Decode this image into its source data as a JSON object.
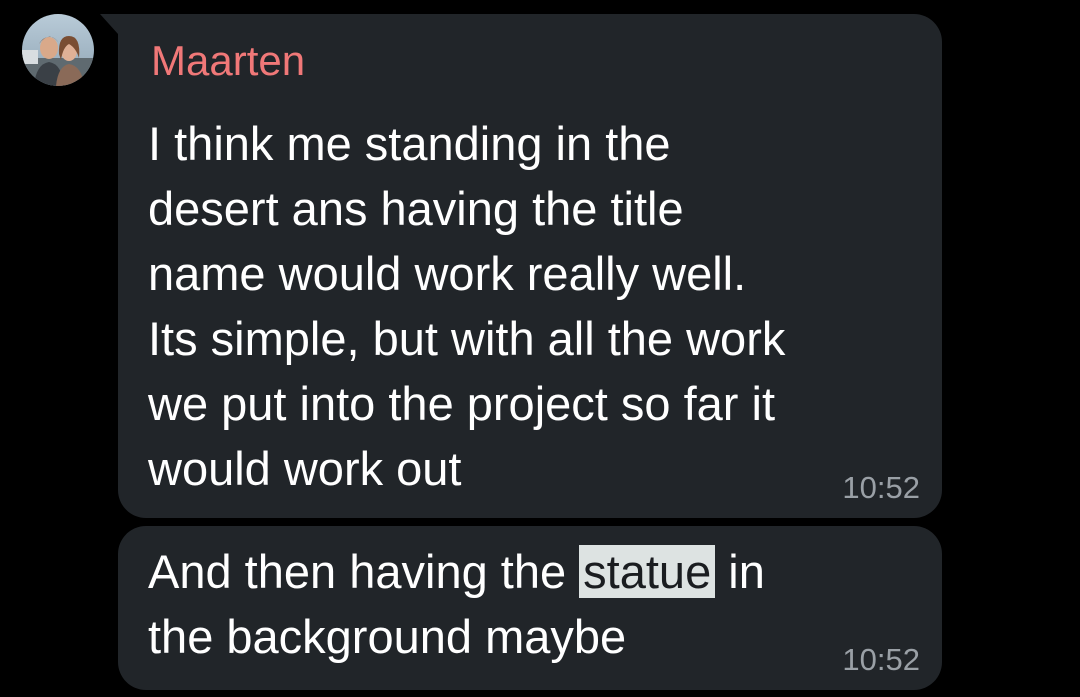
{
  "chat": {
    "accent_color": "#f07878",
    "bubble_color": "#212529",
    "messages": [
      {
        "sender": "Maarten",
        "text": "I think me standing in the\ndesert ans having the title\nname would work really well.\nIts simple, but with all the work\nwe put into the project so far it\nwould work out",
        "time": "10:52"
      },
      {
        "text_before": "And then having the ",
        "text_highlight": "statue",
        "text_after": " in\nthe background maybe",
        "time": "10:52"
      }
    ]
  }
}
